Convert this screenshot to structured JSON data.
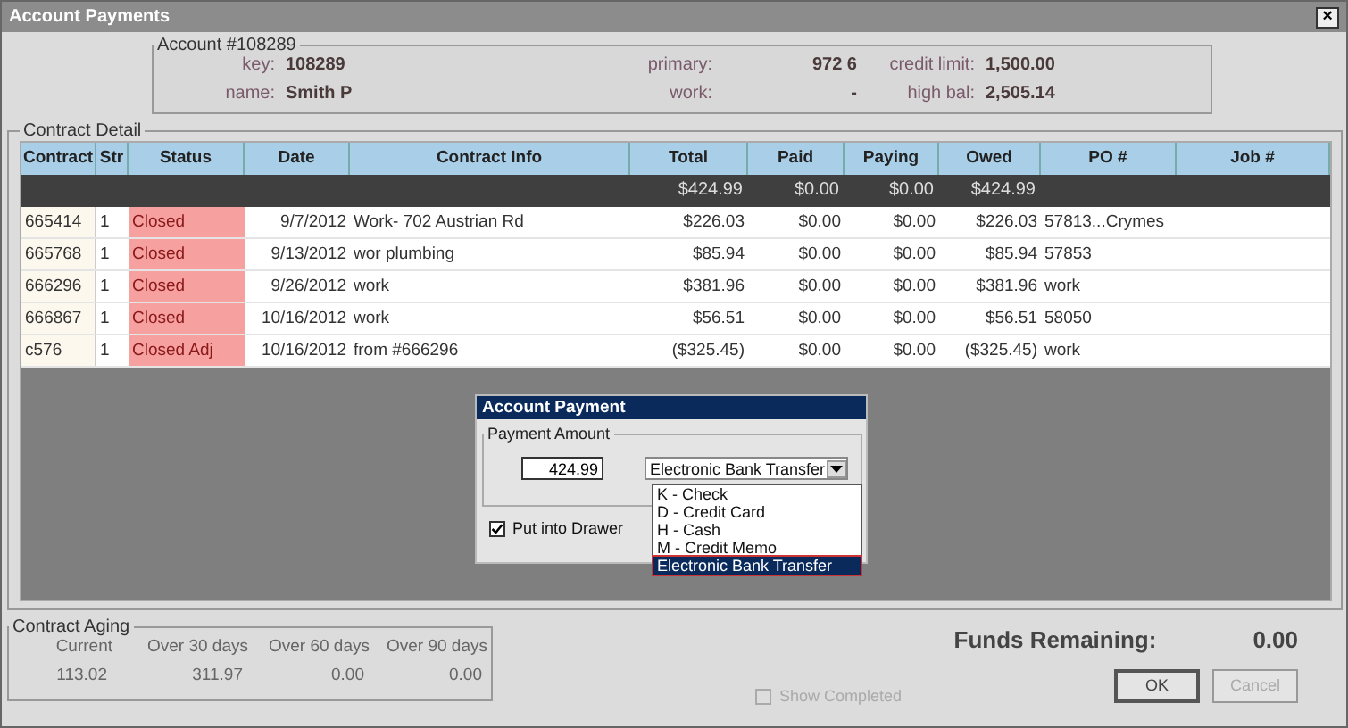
{
  "window": {
    "title": "Account Payments",
    "close": "×"
  },
  "account": {
    "heading": "Account #108289",
    "fields": [
      {
        "label": "key:",
        "value": "108289"
      },
      {
        "label": "primary:",
        "value": "972 6"
      },
      {
        "label": "credit limit:",
        "value": "1,500.00"
      },
      {
        "label": "name:",
        "value": "Smith P"
      },
      {
        "label": "work:",
        "value": "-"
      },
      {
        "label": "high bal:",
        "value": "2,505.14"
      }
    ]
  },
  "contract_detail": {
    "heading": "Contract Detail",
    "columns": [
      "Contract",
      "Str",
      "Status",
      "Date",
      "Contract Info",
      "Total",
      "Paid",
      "Paying",
      "Owed",
      "PO #",
      "Job #"
    ],
    "totals": {
      "total": "$424.99",
      "paid": "$0.00",
      "paying": "$0.00",
      "owed": "$424.99"
    },
    "rows": [
      {
        "contract": "665414",
        "str": "1",
        "status": "Closed",
        "date": "9/7/2012",
        "info": "Work- 702 Austrian Rd",
        "total": "$226.03",
        "paid": "$0.00",
        "paying": "$0.00",
        "owed": "$226.03",
        "po": "57813...Crymes"
      },
      {
        "contract": "665768",
        "str": "1",
        "status": "Closed",
        "date": "9/13/2012",
        "info": "wor plumbing",
        "total": "$85.94",
        "paid": "$0.00",
        "paying": "$0.00",
        "owed": "$85.94",
        "po": "57853"
      },
      {
        "contract": "666296",
        "str": "1",
        "status": "Closed",
        "date": "9/26/2012",
        "info": "work",
        "total": "$381.96",
        "paid": "$0.00",
        "paying": "$0.00",
        "owed": "$381.96",
        "po": "work"
      },
      {
        "contract": "666867",
        "str": "1",
        "status": "Closed",
        "date": "10/16/2012",
        "info": "work",
        "total": "$56.51",
        "paid": "$0.00",
        "paying": "$0.00",
        "owed": "$56.51",
        "po": "58050"
      },
      {
        "contract": "c576",
        "str": "1",
        "status": "Closed Adj",
        "date": "10/16/2012",
        "info": "from #666296",
        "total": "($325.45)",
        "paid": "$0.00",
        "paying": "$0.00",
        "owed": "($325.45)",
        "po": "work"
      }
    ]
  },
  "payment_dialog": {
    "title": "Account Payment",
    "group": "Payment Amount",
    "amount": "424.99",
    "method": "Electronic Bank Transfer",
    "options": [
      {
        "label": "K - Check",
        "selected": false
      },
      {
        "label": "D - Credit Card",
        "selected": false
      },
      {
        "label": "H - Cash",
        "selected": false
      },
      {
        "label": "M - Credit Memo",
        "selected": false
      },
      {
        "label": "Electronic Bank Transfer",
        "selected": true
      }
    ],
    "drawer": {
      "label": "Put into Drawer",
      "checked": true
    }
  },
  "aging": {
    "heading": "Contract Aging",
    "columns": [
      "Current",
      "Over 30 days",
      "Over 60 days",
      "Over 90 days"
    ],
    "values": [
      "113.02",
      "311.97",
      "0.00",
      "0.00"
    ]
  },
  "funds": {
    "label": "Funds Remaining:",
    "value": "0.00"
  },
  "show_completed": {
    "label": "Show Completed",
    "checked": false,
    "disabled": true
  },
  "buttons": [
    {
      "label": "OK",
      "disabled": false
    },
    {
      "label": "Cancel",
      "disabled": true
    }
  ]
}
